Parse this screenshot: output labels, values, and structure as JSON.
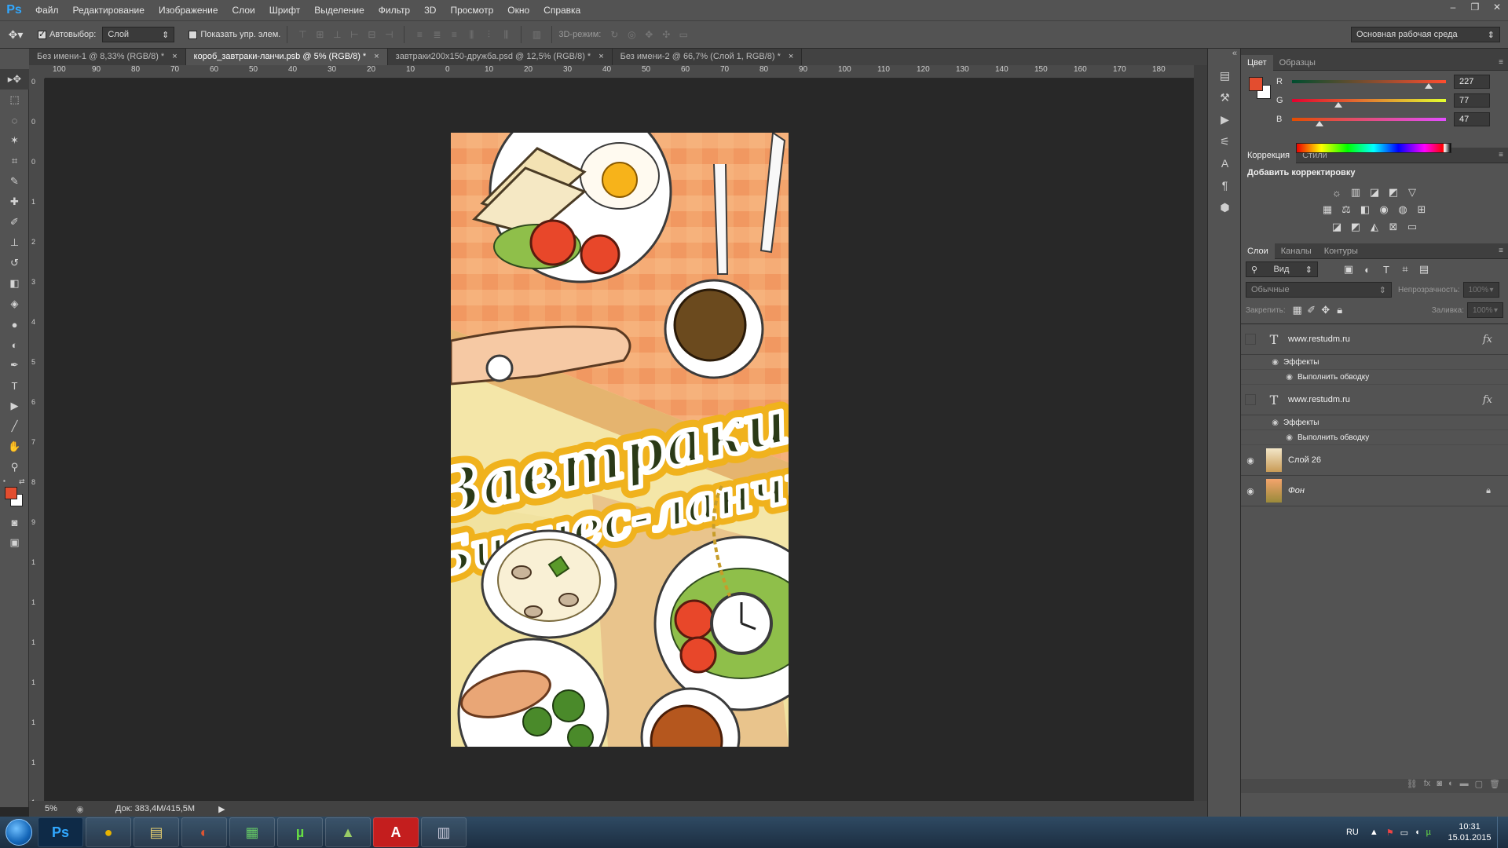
{
  "app": {
    "logo": "Ps"
  },
  "menu": [
    "Файл",
    "Редактирование",
    "Изображение",
    "Слои",
    "Шрифт",
    "Выделение",
    "Фильтр",
    "3D",
    "Просмотр",
    "Окно",
    "Справка"
  ],
  "window_controls": {
    "minimize": "–",
    "restore": "❐",
    "close": "✕"
  },
  "options": {
    "autoselect_label": "Автовыбор:",
    "autoselect_value": "Слой",
    "show_transform_label": "Показать упр. элем.",
    "mode3d_label": "3D-режим:",
    "workspace": "Основная рабочая среда"
  },
  "tabs": [
    {
      "label": "Без имени-1 @ 8,33% (RGB/8) *",
      "close": "×"
    },
    {
      "label": "короб_завтраки-ланчи.psb @ 5% (RGB/8) *",
      "close": "×"
    },
    {
      "label": "завтраки200x150-дружба.psd @ 12,5% (RGB/8) *",
      "close": "×"
    },
    {
      "label": "Без имени-2 @ 66,7% (Слой 1, RGB/8) *",
      "close": "×"
    }
  ],
  "ruler_h": [
    "100",
    "90",
    "80",
    "70",
    "60",
    "50",
    "40",
    "30",
    "20",
    "10",
    "0",
    "10",
    "20",
    "30",
    "40",
    "50",
    "60",
    "70",
    "80",
    "90",
    "100",
    "110",
    "120",
    "130",
    "140",
    "150",
    "160",
    "170",
    "180"
  ],
  "ruler_v": [
    "0",
    "0",
    "0",
    "1",
    "2",
    "3",
    "4",
    "5",
    "6",
    "7",
    "8",
    "9",
    "1",
    "1",
    "1",
    "1",
    "1",
    "1",
    "1"
  ],
  "artwork": {
    "line1": "Завтраки",
    "line2": "Бизнес-ланчи"
  },
  "status": {
    "zoom": "5%",
    "doc": "Док: 383,4M/415,5M"
  },
  "color_panel": {
    "tabs": [
      "Цвет",
      "Образцы"
    ],
    "r_label": "R",
    "g_label": "G",
    "b_label": "B",
    "r": "227",
    "g": "77",
    "b": "47",
    "r_frac": 0.89,
    "g_frac": 0.3,
    "b_frac": 0.18,
    "fg_color": "#e34d2f"
  },
  "correction_panel": {
    "tabs": [
      "Коррекция",
      "Стили"
    ],
    "title": "Добавить корректировку"
  },
  "layers_panel": {
    "tabs": [
      "Слои",
      "Каналы",
      "Контуры"
    ],
    "filter": "Вид",
    "blend": "Обычные",
    "opacity_label": "Непрозрачность:",
    "opacity": "100%",
    "lock_label": "Закрепить:",
    "fill_label": "Заливка:",
    "fill": "100%",
    "layers": [
      {
        "name": "www.restudm.ru",
        "type": "text",
        "fx": "fx",
        "effects": "Эффекты",
        "stroke": "Выполнить обводку"
      },
      {
        "name": "www.restudm.ru",
        "type": "text",
        "fx": "fx",
        "effects": "Эффекты",
        "stroke": "Выполнить обводку"
      },
      {
        "name": "Слой 26",
        "type": "image"
      },
      {
        "name": "Фон",
        "type": "image"
      }
    ]
  },
  "taskbar": {
    "apps": [
      "Ps",
      "●",
      "▤",
      "◐",
      "▦",
      "µ",
      "▲",
      "A",
      "▥"
    ],
    "lang": "RU",
    "time": "10:31",
    "date": "15.01.2015"
  }
}
